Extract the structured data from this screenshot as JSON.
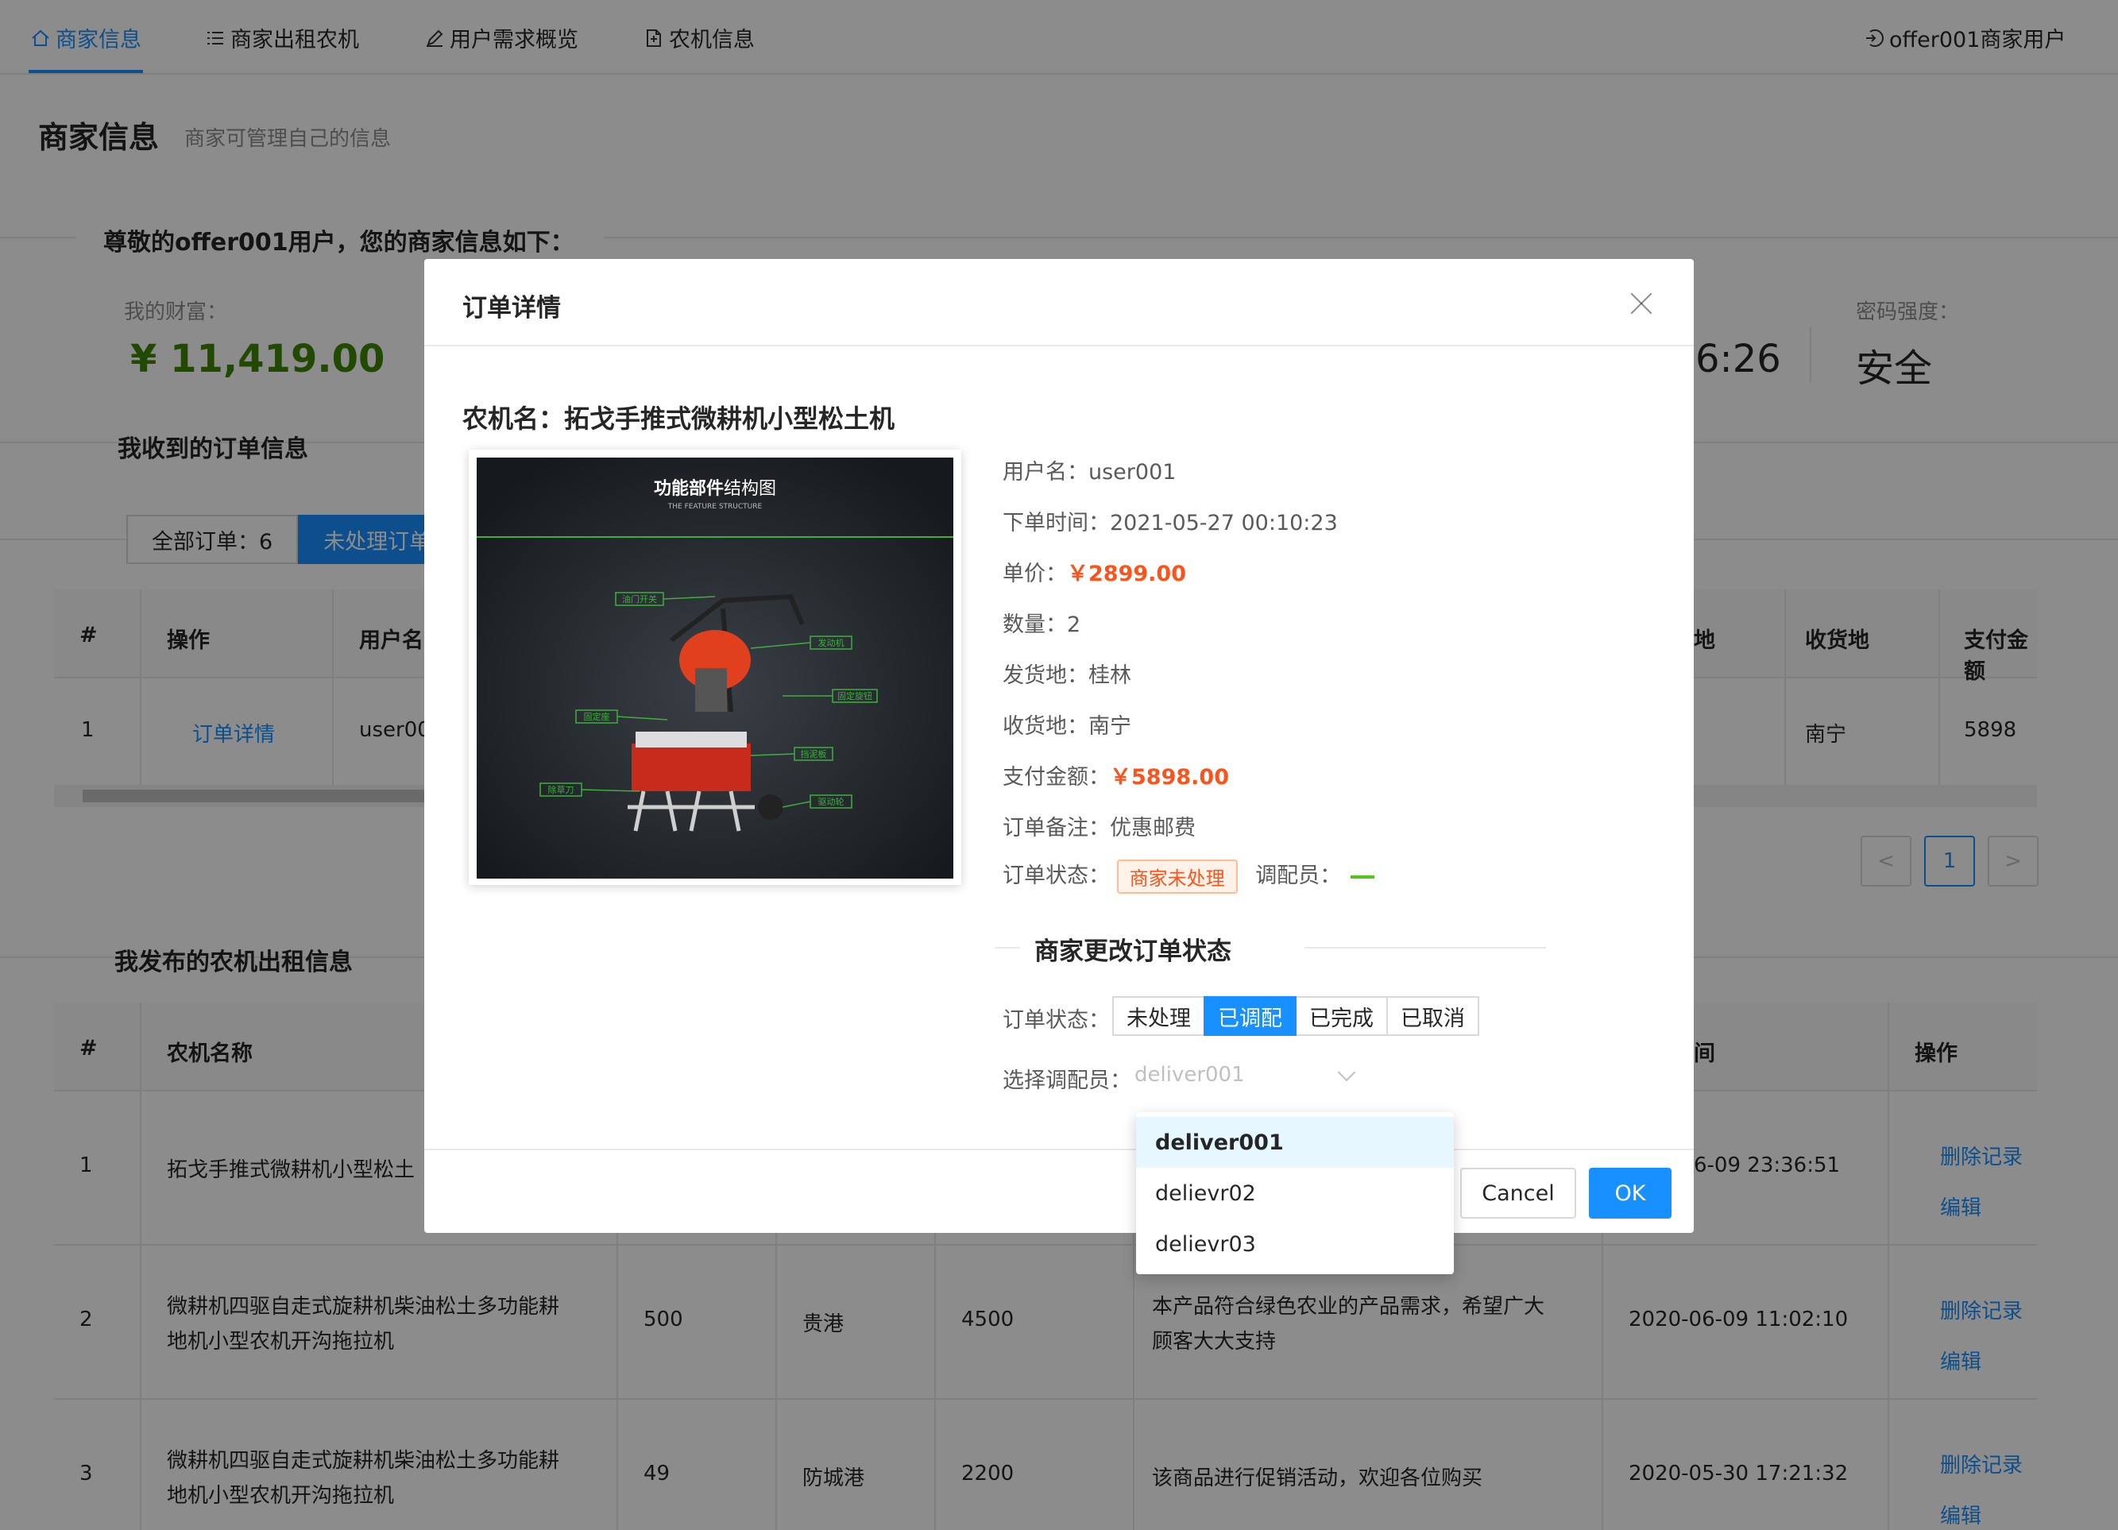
{
  "nav": {
    "items": [
      {
        "label": "商家信息",
        "icon": "home-icon"
      },
      {
        "label": "商家出租农机",
        "icon": "list-icon"
      },
      {
        "label": "用户需求概览",
        "icon": "edit-icon"
      },
      {
        "label": "农机信息",
        "icon": "file-icon"
      }
    ],
    "user": "offer001商家用户",
    "user_icon": "logout-icon",
    "accent": "#1890ff"
  },
  "header": {
    "title": "商家信息",
    "subtitle": "商家可管理自己的信息"
  },
  "greeting": "尊敬的offer001用户，您的商家信息如下：",
  "stats": {
    "wealth_label": "我的财富：",
    "wealth_value": "¥ 11,419.00",
    "time_value_partial": "6:26",
    "password_label": "密码强度：",
    "password_value": "安全"
  },
  "orders_section": {
    "title": "我收到的订单信息",
    "tabs": [
      "全部订单：6",
      "未处理订单"
    ],
    "columns": [
      "#",
      "操作",
      "用户名",
      "地",
      "收货地",
      "支付金额"
    ],
    "row": {
      "index": "1",
      "action": "订单详情",
      "user": "user00",
      "dest": "南宁",
      "amount": "5898"
    },
    "pager": {
      "prev": "<",
      "current": "1",
      "next": ">"
    }
  },
  "rentals_section": {
    "title": "我发布的农机出租信息",
    "columns": [
      "#",
      "农机名称",
      "间",
      "操作"
    ],
    "rows": [
      {
        "index": "1",
        "name": "拓戈手推式微耕机小型松土",
        "qty": "",
        "place": "",
        "price": "",
        "desc": "",
        "time": "6-09 23:36:51",
        "del": "删除记录",
        "edit": "编辑"
      },
      {
        "index": "2",
        "name_l1": "微耕机四驱自走式旋耕机柴油松土多功能耕",
        "name_l2": "地机小型农机开沟拖拉机",
        "qty": "500",
        "place": "贵港",
        "price": "4500",
        "desc_l1": "本产品符合绿色农业的产品需求，希望广大",
        "desc_l2": "顾客大大支持",
        "time": "2020-06-09 11:02:10",
        "del": "删除记录",
        "edit": "编辑"
      },
      {
        "index": "3",
        "name_l1": "微耕机四驱自走式旋耕机柴油松土多功能耕",
        "name_l2": "地机小型农机开沟拖拉机",
        "qty": "49",
        "place": "防城港",
        "price": "2200",
        "desc": "该商品进行促销活动，欢迎各位购买",
        "time": "2020-05-30 17:21:32",
        "del": "删除记录",
        "edit": "编辑"
      }
    ]
  },
  "modal": {
    "title": "订单详情",
    "machine_name": "农机名：拓戈手推式微耕机小型松土机",
    "image": {
      "heading_bold": "功能部件",
      "heading_rest": "结构图",
      "subheading": "THE FEATURE STRUCTURE",
      "callouts": [
        "油门开关",
        "发动机",
        "固定旋钮",
        "固定座",
        "挡泥板",
        "除草刀",
        "驱动轮"
      ]
    },
    "fields": {
      "user": "用户名：user001",
      "time": "下单时间：2021-05-27 00:10:23",
      "unit_price_label": "单价：",
      "unit_price": "￥2899.00",
      "qty": "数量：2",
      "from": "发货地：桂林",
      "to": "收货地：南宁",
      "pay_label": "支付金额：",
      "pay": "￥5898.00",
      "note": "订单备注：优惠邮费",
      "status_label": "订单状态：",
      "status_tag": "商家未处理",
      "dispatcher_label": "调配员："
    },
    "change_title": "商家更改订单状态",
    "seg_label": "订单状态：",
    "seg_options": [
      "未处理",
      "已调配",
      "已完成",
      "已取消"
    ],
    "seg_selected": "已调配",
    "select_label": "选择调配员：",
    "select_placeholder": "deliver001",
    "dropdown": [
      "deliver001",
      "delievr02",
      "delievr03"
    ],
    "cancel": "Cancel",
    "ok": "OK"
  }
}
